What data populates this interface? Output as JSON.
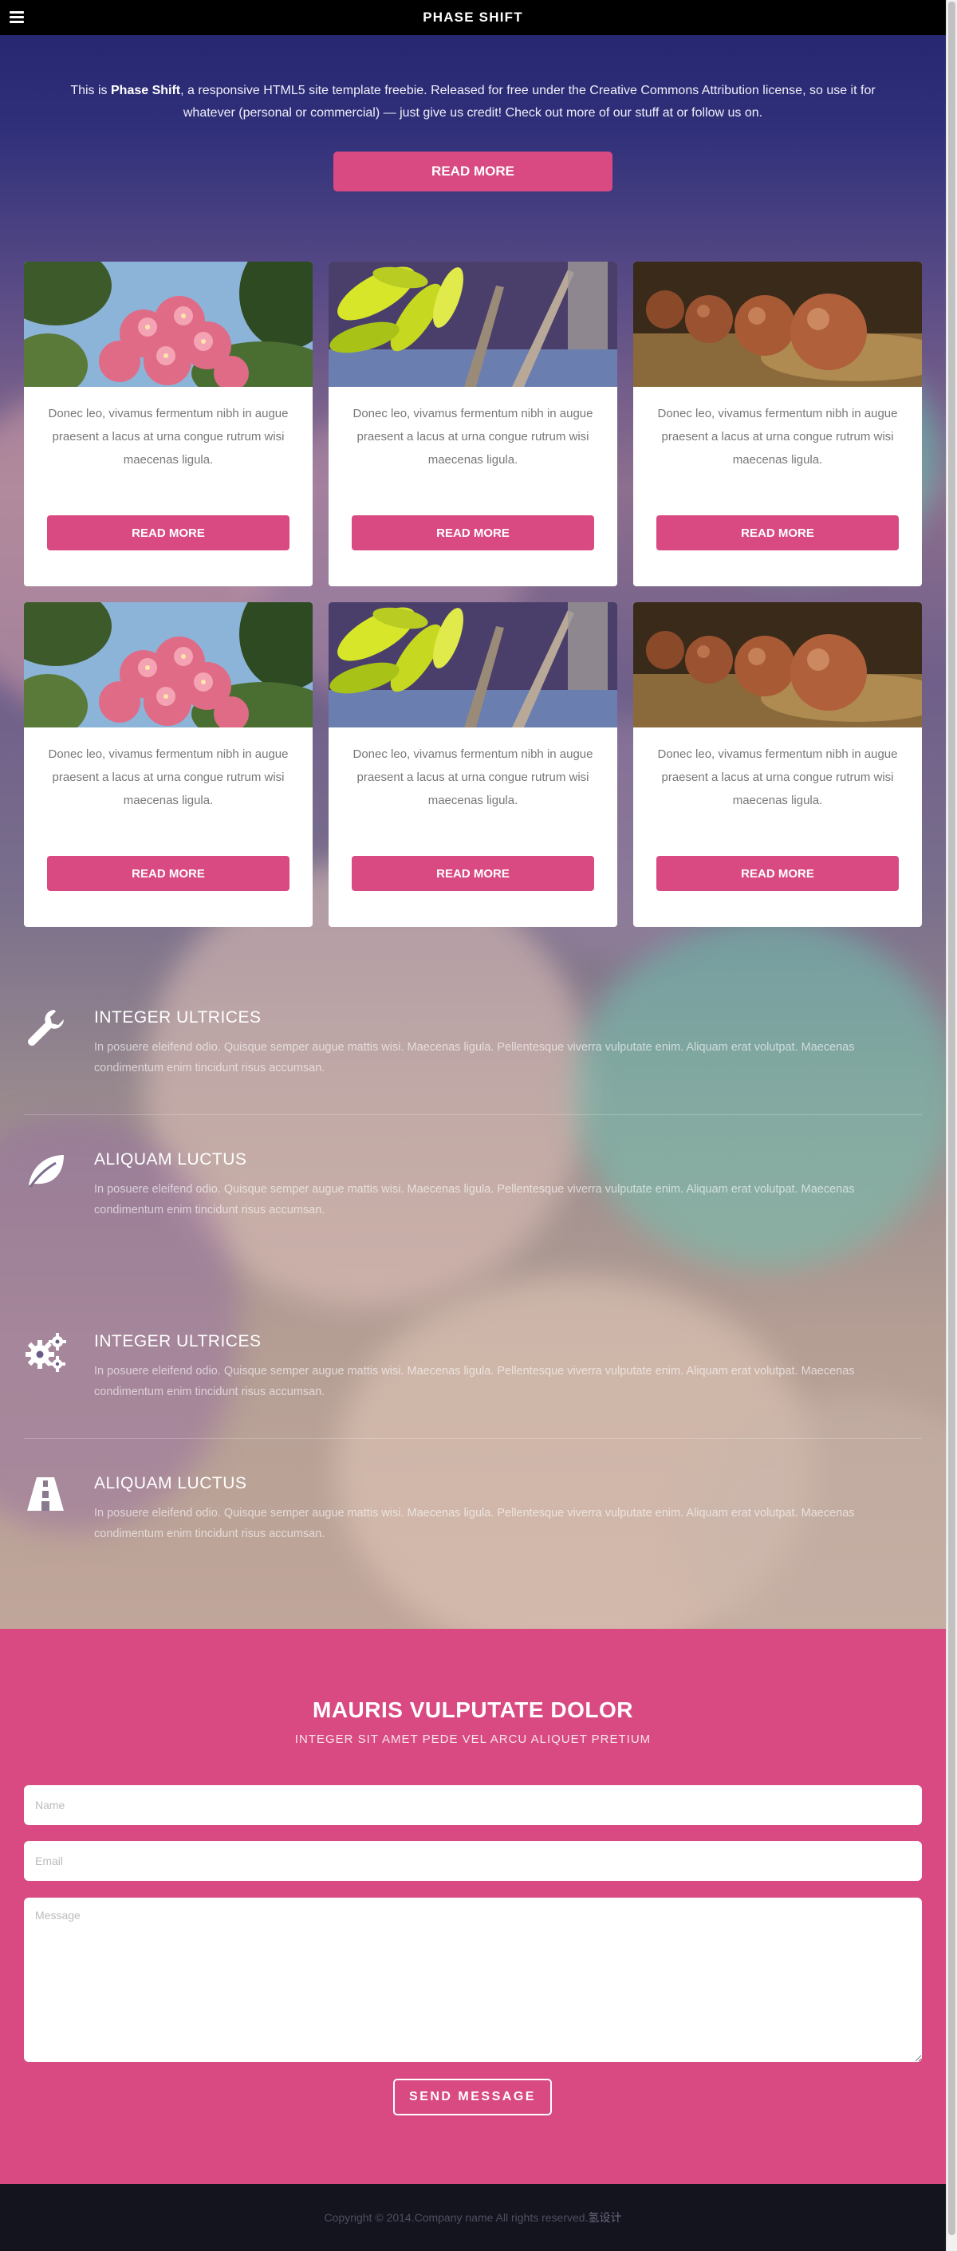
{
  "header": {
    "title": "PHASE SHIFT"
  },
  "intro": {
    "text_before": "This is ",
    "brand": "Phase Shift",
    "text_after": ", a responsive HTML5 site template freebie. Released for free under the Creative Commons Attribution license, so use it for whatever (personal or commercial) — just give us credit! Check out more of our stuff at or follow us on.",
    "button_label": "READ MORE"
  },
  "cards": [
    {
      "image": "pink-flowers",
      "text": "Donec leo, vivamus fermentum nibh in augue praesent a lacus at urna congue rutrum wisi maecenas ligula.",
      "button": "READ MORE"
    },
    {
      "image": "yellow-leaves",
      "text": "Donec leo, vivamus fermentum nibh in augue praesent a lacus at urna congue rutrum wisi maecenas ligula.",
      "button": "READ MORE"
    },
    {
      "image": "brown-balls",
      "text": "Donec leo, vivamus fermentum nibh in augue praesent a lacus at urna congue rutrum wisi maecenas ligula.",
      "button": "READ MORE"
    },
    {
      "image": "pink-flowers",
      "text": "Donec leo, vivamus fermentum nibh in augue praesent a lacus at urna congue rutrum wisi maecenas ligula.",
      "button": "READ MORE"
    },
    {
      "image": "yellow-leaves",
      "text": "Donec leo, vivamus fermentum nibh in augue praesent a lacus at urna congue rutrum wisi maecenas ligula.",
      "button": "READ MORE"
    },
    {
      "image": "brown-balls",
      "text": "Donec leo, vivamus fermentum nibh in augue praesent a lacus at urna congue rutrum wisi maecenas ligula.",
      "button": "READ MORE"
    }
  ],
  "features": [
    {
      "icon": "wrench-icon",
      "title": "INTEGER ULTRICES",
      "text": "In posuere eleifend odio. Quisque semper augue mattis wisi. Maecenas ligula. Pellentesque viverra vulputate enim. Aliquam erat volutpat. Maecenas condimentum enim tincidunt risus accumsan."
    },
    {
      "icon": "leaf-icon",
      "title": "ALIQUAM LUCTUS",
      "text": "In posuere eleifend odio. Quisque semper augue mattis wisi. Maecenas ligula. Pellentesque viverra vulputate enim. Aliquam erat volutpat. Maecenas condimentum enim tincidunt risus accumsan."
    },
    {
      "icon": "gears-icon",
      "title": "INTEGER ULTRICES",
      "text": "In posuere eleifend odio. Quisque semper augue mattis wisi. Maecenas ligula. Pellentesque viverra vulputate enim. Aliquam erat volutpat. Maecenas condimentum enim tincidunt risus accumsan."
    },
    {
      "icon": "road-icon",
      "title": "ALIQUAM LUCTUS",
      "text": "In posuere eleifend odio. Quisque semper augue mattis wisi. Maecenas ligula. Pellentesque viverra vulputate enim. Aliquam erat volutpat. Maecenas condimentum enim tincidunt risus accumsan."
    }
  ],
  "contact": {
    "title": "MAURIS VULPUTATE DOLOR",
    "subtitle": "INTEGER SIT AMET PEDE VEL ARCU ALIQUET PRETIUM",
    "name_placeholder": "Name",
    "email_placeholder": "Email",
    "message_placeholder": "Message",
    "send_label": "SEND MESSAGE"
  },
  "footer": {
    "copyright": "Copyright © 2014.Company name All rights reserved.",
    "link": "氢设计"
  },
  "colors": {
    "accent": "#d94a82",
    "header_bg": "#000000",
    "footer_bg": "#14141e"
  }
}
